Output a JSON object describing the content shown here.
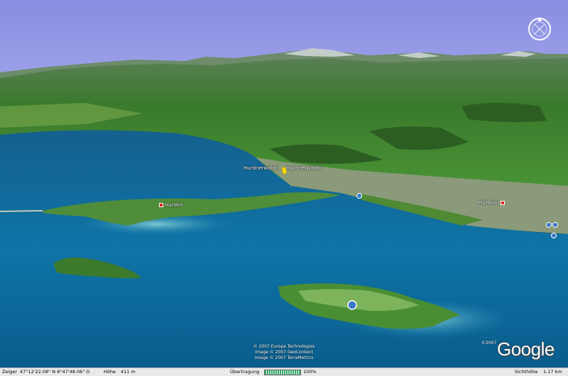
{
  "places": [
    {
      "name": "Hurdnerwäldli",
      "marker": "none"
    },
    {
      "name": "Hurdnerwäldli",
      "marker": "none"
    },
    {
      "name": "Hurden",
      "marker": "square"
    },
    {
      "name": "Pfäffikon",
      "marker": "square"
    }
  ],
  "credits": [
    "© 2007 Europa Technologies",
    "Image © 2007 GeoContent",
    "Image © 2007 TerraMetrics"
  ],
  "logo": {
    "text": "Google",
    "year": "©2007"
  },
  "status": {
    "pointer_label": "Zeiger",
    "pointer_value": "47°12'22.08\" N   8°47'48.06\" O",
    "height_label": "Höhe",
    "height_value": "411 m",
    "transfer_label": "Übertragung",
    "transfer_percent": 100,
    "transfer_text": "100%",
    "eye_label": "Sichthöhe",
    "eye_value": "1.17 km"
  },
  "colors": {
    "sky": "#8d8fe0",
    "water_deep": "#0d6aa0",
    "water_shallow": "#5fb4c8",
    "land": "#3f8a2c",
    "marker": "#d22222"
  }
}
